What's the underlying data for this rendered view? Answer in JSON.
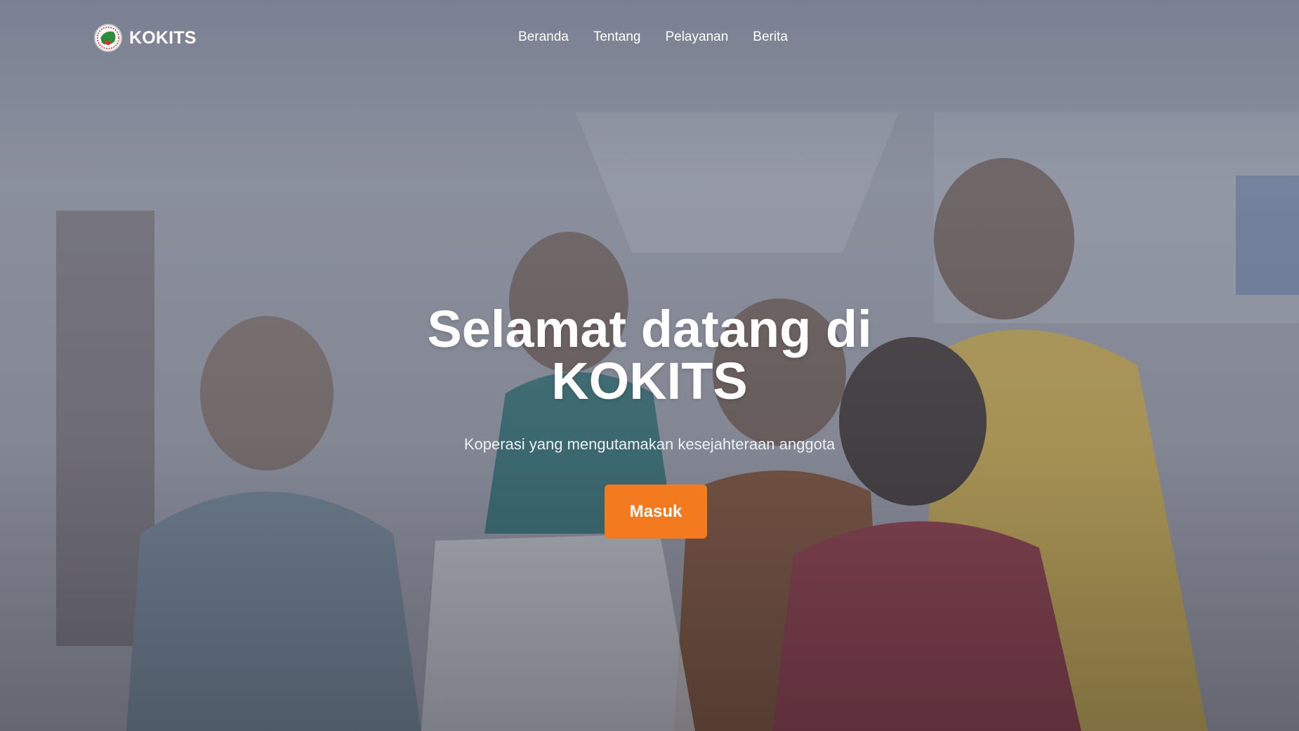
{
  "brand": {
    "name": "KOKITS",
    "logo_icon": "kokits-logo-icon"
  },
  "nav": {
    "items": [
      {
        "label": "Beranda"
      },
      {
        "label": "Tentang"
      },
      {
        "label": "Pelayanan"
      },
      {
        "label": "Berita"
      }
    ]
  },
  "hero": {
    "title_line1": "Selamat datang di",
    "title_line2": "KOKITS",
    "subtitle": "Koperasi yang mengutamakan kesejahteraan anggota",
    "cta_label": "Masuk"
  },
  "colors": {
    "accent": "#f47a1f",
    "text": "#ffffff"
  }
}
